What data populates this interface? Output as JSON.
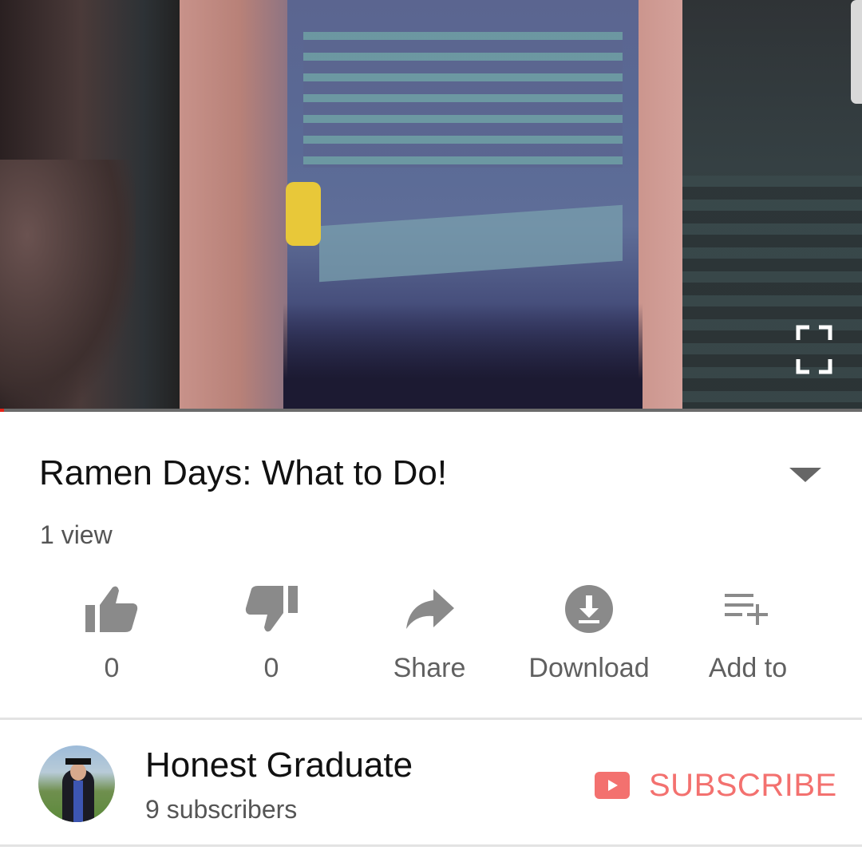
{
  "video": {
    "title": "Ramen Days: What to Do!",
    "views": "1 view",
    "progress_fraction": 0.005
  },
  "actions": {
    "like": {
      "icon": "thumbs-up-icon",
      "label": "0"
    },
    "dislike": {
      "icon": "thumbs-down-icon",
      "label": "0"
    },
    "share": {
      "icon": "share-arrow-icon",
      "label": "Share"
    },
    "download": {
      "icon": "download-icon",
      "label": "Download"
    },
    "add_to": {
      "icon": "playlist-add-icon",
      "label": "Add to"
    }
  },
  "channel": {
    "name": "Honest Graduate",
    "subscribers": "9 subscribers",
    "subscribe_label": "SUBSCRIBE"
  },
  "colors": {
    "accent_red": "#f3716f",
    "progress_red": "#e62117",
    "icon_gray": "#8a8a8a",
    "text_dark": "#111111",
    "text_secondary": "#555555"
  }
}
